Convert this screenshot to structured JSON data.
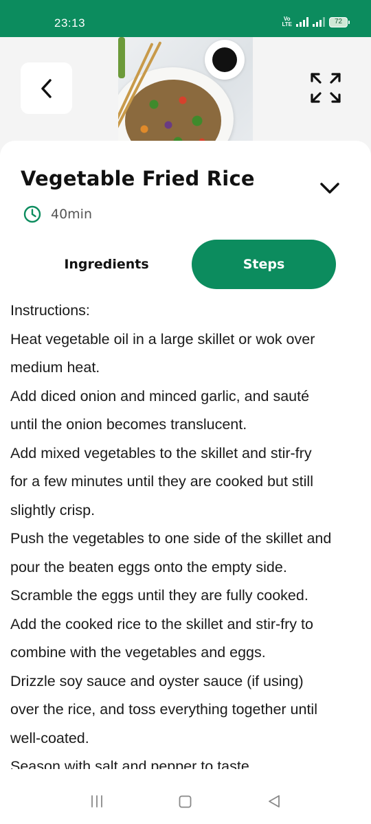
{
  "status": {
    "time": "23:13",
    "network_label": "Vo LTE",
    "battery": "72"
  },
  "recipe": {
    "title": "Vegetable Fried Rice",
    "time": "40min"
  },
  "tabs": {
    "ingredients_label": "Ingredients",
    "steps_label": "Steps",
    "active": "Steps"
  },
  "steps": {
    "lines": [
      "Instructions:",
      "Heat vegetable oil in a large skillet or wok over",
      "medium heat.",
      "Add diced onion and minced garlic, and sauté",
      "until the onion becomes translucent.",
      "Add mixed vegetables to the skillet and stir-fry",
      "for a few minutes until they are cooked but still",
      "slightly crisp.",
      "Push the vegetables to one side of the skillet and",
      "pour the beaten eggs onto the empty side.",
      "Scramble the eggs until they are fully cooked.",
      "Add the cooked rice to the skillet and stir-fry to",
      "combine with the vegetables and eggs.",
      "Drizzle soy sauce and oyster sauce (if using)",
      "over the rice, and toss everything together until",
      "well-coated.",
      "Season with salt and pepper to taste."
    ]
  },
  "icons": {
    "back": "chevron-left-icon",
    "fullscreen": "expand-arrows-icon",
    "collapse": "chevron-down-icon",
    "clock": "clock-icon",
    "nav_menu": "menu-lines-icon",
    "nav_home": "square-home-icon",
    "nav_back": "triangle-back-icon"
  },
  "colors": {
    "accent": "#0c8c5e",
    "text": "#111111",
    "muted": "#555555"
  }
}
